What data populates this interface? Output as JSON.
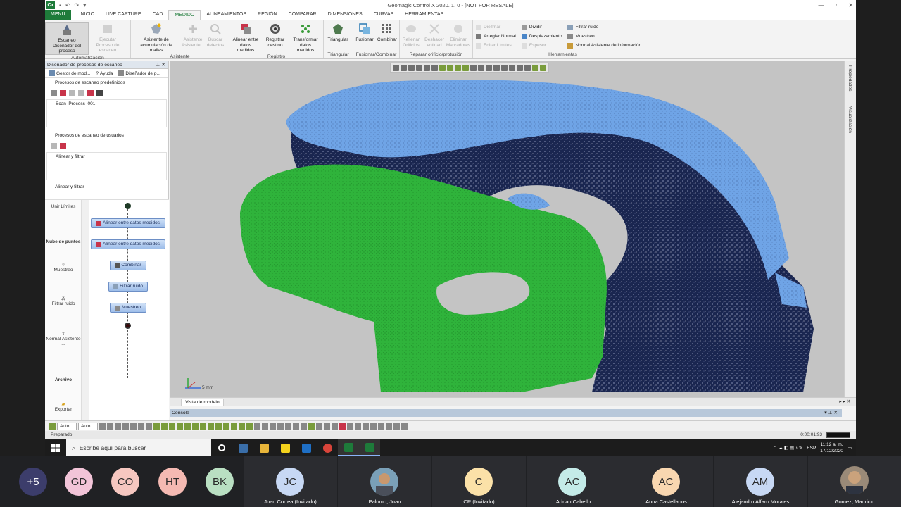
{
  "window": {
    "title": "Geomagic Control X 2020. 1. 0 - [NOT FOR RESALE]",
    "logo": "Cx"
  },
  "tabs": [
    "MENÚ",
    "INICIO",
    "LIVE CAPTURE",
    "CAD",
    "MEDIDO",
    "ALINEAMIENTOS",
    "REGIÓN",
    "COMPARAR",
    "DIMENSIONES",
    "CURVAS",
    "HERRAMIENTAS"
  ],
  "active_tab": "MEDIDO",
  "ribbon": {
    "automatizacion": {
      "label": "Automatización",
      "b1": "Escaneo Diseñador del proceso",
      "b2": "Ejecutar Proceso de escaneo"
    },
    "asistente": {
      "label": "Asistente",
      "b1": "Asistente de acumulación de mallas",
      "b2": "Asistente Asistente...",
      "b3": "Buscar defectos"
    },
    "registro": {
      "label": "Registro",
      "b1": "Alinear entre datos medidos",
      "b2": "Registrar destino",
      "b3": "Transformar datos medidos"
    },
    "triangular": {
      "label": "Triangular",
      "b1": "Triangular"
    },
    "fusionar": {
      "label": "Fusionar/Combinar",
      "b1": "Fusionar",
      "b2": "Combinar"
    },
    "reparar": {
      "label": "Reparar orificio/protusión",
      "b1": "Rellenar Orificios",
      "b2": "Deshacer entidad",
      "b3": "Eliminar Marcadores"
    },
    "herramientas": {
      "label": "Herramientas",
      "s1": "Diezmar",
      "s2": "Arreglar Normal",
      "s3": "Editar Límites",
      "s4": "Dividir",
      "s5": "Desplazamiento",
      "s6": "Espesor",
      "s7": "Filtrar ruido",
      "s8": "Muestreo",
      "s9": "Normal Asistente de información"
    }
  },
  "panel": {
    "title": "Diseñador de procesos de escaneo",
    "tabs": [
      "Gestor de mod...",
      "Ayuda",
      "Diseñador de p..."
    ],
    "predef_head": "Procesos de escaneo predefinidos",
    "predef_item": "Scan_Process_001",
    "user_head": "Procesos de escaneo de usuarios",
    "user_item": "Alinear y filtrar",
    "flow_head": "Alinear y filtrar"
  },
  "flow_tools": {
    "t1": "Unir Límites",
    "t2": "Nube de puntos",
    "t3": "Muestreo",
    "t4": "Filtrar ruido",
    "t5": "Normal Asistente ...",
    "t6": "Archivo",
    "t7": "Exportar"
  },
  "flow_nodes": {
    "n1": "Alinear entre datos medidos",
    "n2": "Alinear entre datos medidos",
    "n3": "Combinar",
    "n4": "Filtrar ruido",
    "n5": "Muestreo"
  },
  "viewport": {
    "scale": "5 mm",
    "tab": "Vista de modelo",
    "side1": "Propiedades",
    "side2": "Visualización"
  },
  "console": "Consola",
  "bottom": {
    "sel1": "Auto",
    "sel2": "Auto"
  },
  "status": {
    "text": "Preparado",
    "time": "0:00:01:93"
  },
  "taskbar": {
    "search": "Escribe aquí para buscar",
    "lang": "ESP",
    "time": "11:12 a. m.",
    "date": "17/12/2020"
  },
  "participants": [
    {
      "initials": "+5",
      "name": "",
      "color": "#3c3d6b"
    },
    {
      "initials": "GD",
      "name": "",
      "color": "#f2c4d8"
    },
    {
      "initials": "CO",
      "name": "",
      "color": "#f6c7c0"
    },
    {
      "initials": "HT",
      "name": "",
      "color": "#f4b9b2"
    },
    {
      "initials": "BK",
      "name": "",
      "color": "#b9dfc2"
    },
    {
      "initials": "JC",
      "name": "Juan Correa (Invitado)",
      "color": "#c7d8f4"
    },
    {
      "initials": "",
      "name": "Palomo, Juan",
      "color": "#7aa0b8"
    },
    {
      "initials": "C",
      "name": "CR (Invitado)",
      "color": "#fbe1a8"
    },
    {
      "initials": "AC",
      "name": "Adrian Cabello",
      "color": "#c4ebe8"
    },
    {
      "initials": "AC",
      "name": "Anna Castellanos",
      "color": "#f9d7b0"
    },
    {
      "initials": "AM",
      "name": "Alejandro Alfaro Morales",
      "color": "#c7d8f4"
    },
    {
      "initials": "",
      "name": "Gomez, Mauricio",
      "color": "#9a8a78"
    }
  ],
  "colors": {
    "brand_green": "#1e7b3a",
    "mesh_green": "#2fb33b",
    "mesh_blue": "#6fa4e6",
    "mesh_navy": "#1a2650"
  }
}
